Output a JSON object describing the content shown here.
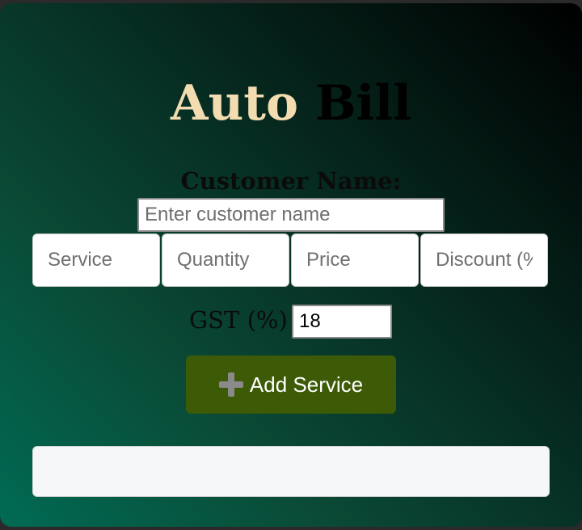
{
  "app": {
    "title_word1": "Auto",
    "title_word2": "Bill"
  },
  "colors": {
    "title_word1": "#f2dcb0",
    "title_word2": "#000000",
    "button_bg": "#3d5a06",
    "gradient_from": "#006b54",
    "gradient_to": "#000000"
  },
  "customer": {
    "label": "Customer Name:",
    "placeholder": "Enter customer name",
    "value": ""
  },
  "service_fields": {
    "service_placeholder": "Service",
    "quantity_placeholder": "Quantity",
    "price_placeholder": "Price",
    "discount_placeholder": "Discount (%)"
  },
  "gst": {
    "label": "GST (%)",
    "value": "18"
  },
  "add_button": {
    "icon": "plus-icon",
    "label": "Add Service"
  },
  "output": {
    "text": ""
  }
}
